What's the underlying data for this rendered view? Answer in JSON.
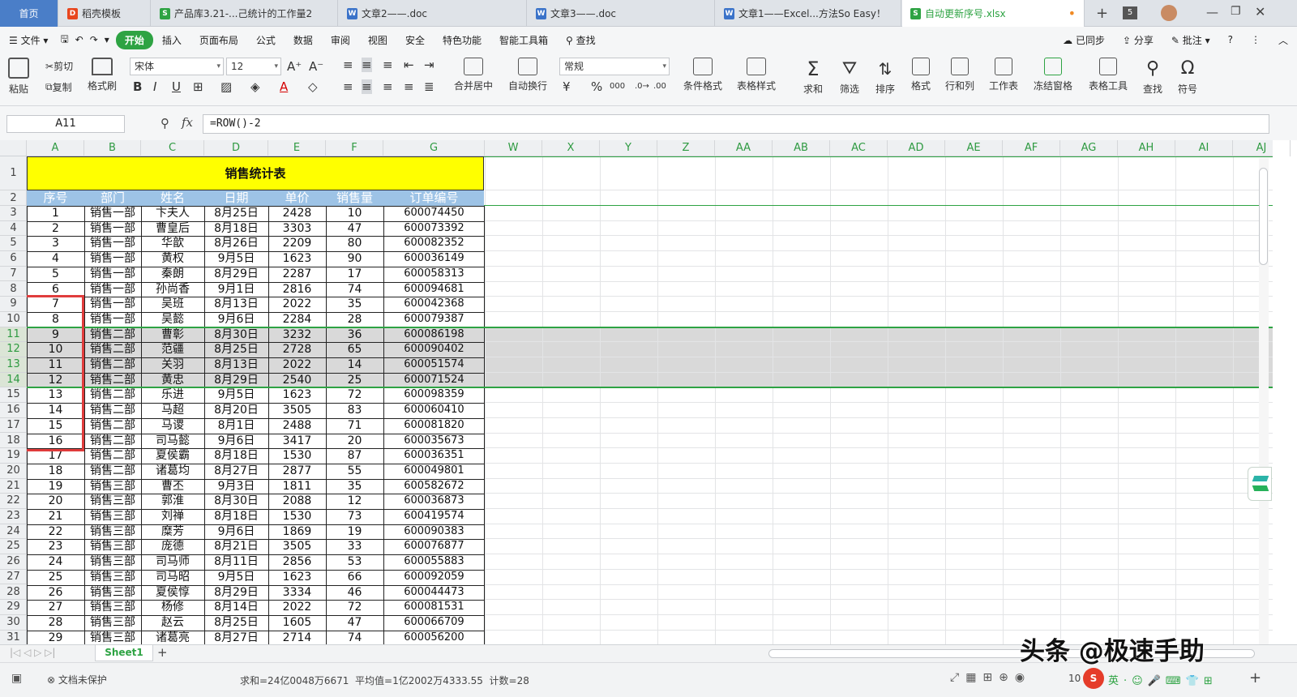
{
  "tabs": [
    {
      "label": "首页"
    },
    {
      "label": "稻壳模板"
    },
    {
      "label": "产品库3.21-...己统计的工作量2"
    },
    {
      "label": "文章2——.doc"
    },
    {
      "label": "文章3——.doc"
    },
    {
      "label": "文章1——Excel...方法So Easy！"
    },
    {
      "label": "自动更新序号.xlsx"
    }
  ],
  "tab_count": "5",
  "menu": {
    "file": "文件",
    "items": [
      "开始",
      "插入",
      "页面布局",
      "公式",
      "数据",
      "审阅",
      "视图",
      "安全",
      "特色功能",
      "智能工具箱"
    ],
    "search": "查找",
    "sync": "已同步",
    "share": "分享",
    "comment": "批注"
  },
  "ribbon": {
    "paste": "粘贴",
    "cut": "剪切",
    "copy": "复制",
    "format_painter": "格式刷",
    "font": "宋体",
    "size": "12",
    "merge": "合并居中",
    "wrap": "自动换行",
    "numfmt": "常规",
    "cond": "条件格式",
    "tblstyle": "表格样式",
    "sum": "求和",
    "filter": "筛选",
    "sort": "排序",
    "format": "格式",
    "rowcol": "行和列",
    "worksheet": "工作表",
    "freeze": "冻结窗格",
    "tools": "表格工具",
    "find": "查找",
    "symbol": "符号"
  },
  "formula": {
    "cell": "A11",
    "fx": "fx",
    "text": "=ROW()-2"
  },
  "columns": [
    "A",
    "B",
    "C",
    "D",
    "E",
    "F",
    "G",
    "W",
    "X",
    "Y",
    "Z",
    "AA",
    "AB",
    "AC",
    "AD",
    "AE",
    "AF",
    "AG",
    "AH",
    "AI",
    "AJ"
  ],
  "table": {
    "title": "销售统计表",
    "headers": [
      "序号",
      "部门",
      "姓名",
      "日期",
      "单价",
      "销售量",
      "订单编号"
    ],
    "rows": [
      [
        "1",
        "销售一部",
        "卞夫人",
        "8月25日",
        "2428",
        "10",
        "600074450"
      ],
      [
        "2",
        "销售一部",
        "曹皇后",
        "8月18日",
        "3303",
        "47",
        "600073392"
      ],
      [
        "3",
        "销售一部",
        "华歆",
        "8月26日",
        "2209",
        "80",
        "600082352"
      ],
      [
        "4",
        "销售一部",
        "黄权",
        "9月5日",
        "1623",
        "90",
        "600036149"
      ],
      [
        "5",
        "销售一部",
        "秦朗",
        "8月29日",
        "2287",
        "17",
        "600058313"
      ],
      [
        "6",
        "销售一部",
        "孙尚香",
        "9月1日",
        "2816",
        "74",
        "600094681"
      ],
      [
        "7",
        "销售一部",
        "吴班",
        "8月13日",
        "2022",
        "35",
        "600042368"
      ],
      [
        "8",
        "销售一部",
        "吴懿",
        "9月6日",
        "2284",
        "28",
        "600079387"
      ],
      [
        "9",
        "销售二部",
        "曹彰",
        "8月30日",
        "3232",
        "36",
        "600086198"
      ],
      [
        "10",
        "销售二部",
        "范疆",
        "8月25日",
        "2728",
        "65",
        "600090402"
      ],
      [
        "11",
        "销售二部",
        "关羽",
        "8月13日",
        "2022",
        "14",
        "600051574"
      ],
      [
        "12",
        "销售二部",
        "黄忠",
        "8月29日",
        "2540",
        "25",
        "600071524"
      ],
      [
        "13",
        "销售二部",
        "乐进",
        "9月5日",
        "1623",
        "72",
        "600098359"
      ],
      [
        "14",
        "销售二部",
        "马超",
        "8月20日",
        "3505",
        "83",
        "600060410"
      ],
      [
        "15",
        "销售二部",
        "马谡",
        "8月1日",
        "2488",
        "71",
        "600081820"
      ],
      [
        "16",
        "销售二部",
        "司马懿",
        "9月6日",
        "3417",
        "20",
        "600035673"
      ],
      [
        "17",
        "销售二部",
        "夏侯霸",
        "8月18日",
        "1530",
        "87",
        "600036351"
      ],
      [
        "18",
        "销售二部",
        "诸葛均",
        "8月27日",
        "2877",
        "55",
        "600049801"
      ],
      [
        "19",
        "销售三部",
        "曹丕",
        "9月3日",
        "1811",
        "35",
        "600582672"
      ],
      [
        "20",
        "销售三部",
        "郭淮",
        "8月30日",
        "2088",
        "12",
        "600036873"
      ],
      [
        "21",
        "销售三部",
        "刘禅",
        "8月18日",
        "1530",
        "73",
        "600419574"
      ],
      [
        "22",
        "销售三部",
        "糜芳",
        "9月6日",
        "1869",
        "19",
        "600090383"
      ],
      [
        "23",
        "销售三部",
        "庞德",
        "8月21日",
        "3505",
        "33",
        "600076877"
      ],
      [
        "24",
        "销售三部",
        "司马师",
        "8月11日",
        "2856",
        "53",
        "600055883"
      ],
      [
        "25",
        "销售三部",
        "司马昭",
        "9月5日",
        "1623",
        "66",
        "600092059"
      ],
      [
        "26",
        "销售三部",
        "夏侯惇",
        "8月29日",
        "3334",
        "46",
        "600044473"
      ],
      [
        "27",
        "销售三部",
        "杨修",
        "8月14日",
        "2022",
        "72",
        "600081531"
      ],
      [
        "28",
        "销售三部",
        "赵云",
        "8月25日",
        "1605",
        "47",
        "600066709"
      ],
      [
        "29",
        "销售三部",
        "诸葛亮",
        "8月27日",
        "2714",
        "74",
        "600056200"
      ]
    ]
  },
  "sheet_tab": "Sheet1",
  "status": {
    "protect": "文档未保护",
    "summary": "求和=24亿0048万6671  平均值=1亿2002万4333.55  计数=28",
    "zoom": "10"
  },
  "watermark": "头条 @极速手助",
  "colors": {
    "accent": "#2ea343",
    "title_bg": "#ffff00",
    "header_bg": "#9dc3e6",
    "selection": "#d9d9d9",
    "highlight_box": "#e03c3c"
  }
}
